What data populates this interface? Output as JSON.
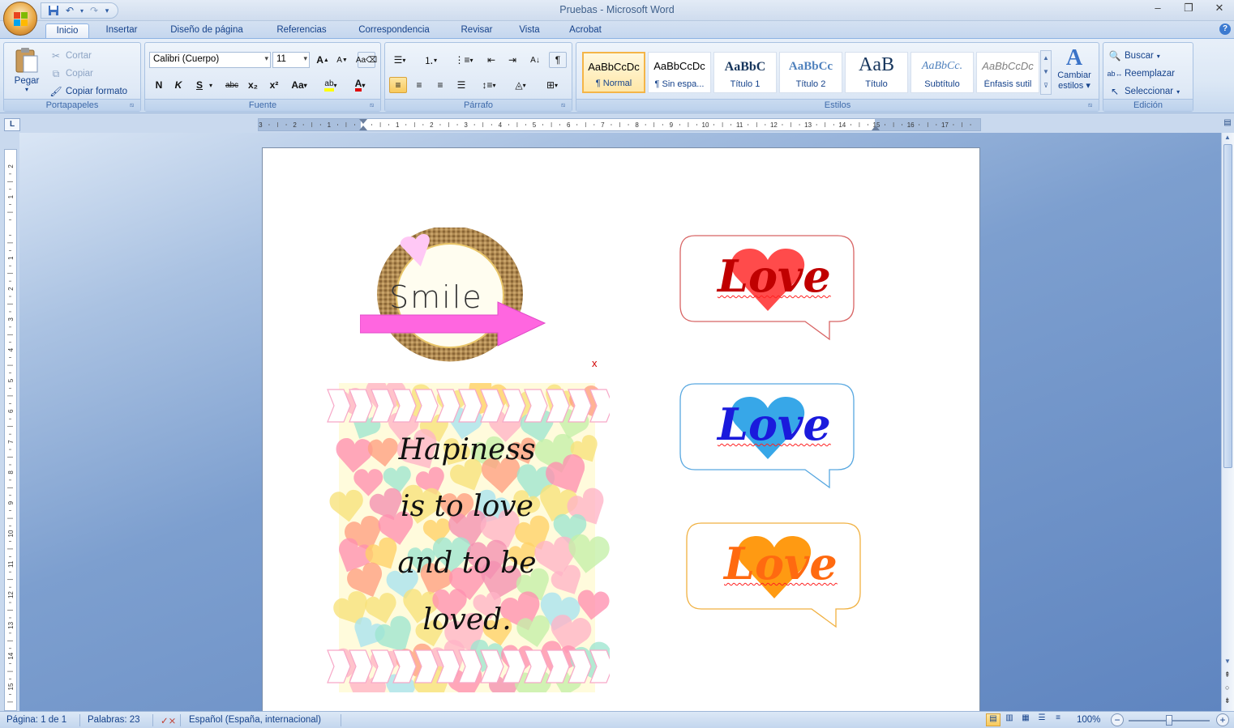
{
  "window": {
    "title": "Pruebas - Microsoft Word",
    "controls": [
      "–",
      "❐",
      "✕"
    ]
  },
  "tabs": [
    "Inicio",
    "Insertar",
    "Diseño de página",
    "Referencias",
    "Correspondencia",
    "Revisar",
    "Vista",
    "Acrobat"
  ],
  "active_tab": "Inicio",
  "clipboard": {
    "paste": "Pegar",
    "cut": "Cortar",
    "copy": "Copiar",
    "format_painter": "Copiar formato",
    "group_label": "Portapapeles"
  },
  "font": {
    "name": "Calibri (Cuerpo)",
    "size": "11",
    "group_label": "Fuente",
    "bold": "N",
    "italic": "K",
    "underline": "S",
    "strike": "abc",
    "subscript": "x₂",
    "superscript": "x²",
    "case": "Aa",
    "grow": "A",
    "shrink": "A",
    "highlight": "ab",
    "color": "A"
  },
  "paragraph": {
    "group_label": "Párrafo"
  },
  "styles": {
    "group_label": "Estilos",
    "items": [
      {
        "preview": "AaBbCcDc",
        "name": "¶ Normal"
      },
      {
        "preview": "AaBbCcDc",
        "name": "¶ Sin espa..."
      },
      {
        "preview": "AaBbC",
        "name": "Título 1"
      },
      {
        "preview": "AaBbCc",
        "name": "Título 2"
      },
      {
        "preview": "AaB",
        "name": "Título"
      },
      {
        "preview": "AaBbCc.",
        "name": "Subtítulo"
      },
      {
        "preview": "AaBbCcDc",
        "name": "Énfasis sutil"
      }
    ],
    "change_styles_line1": "Cambiar",
    "change_styles_line2": "estilos"
  },
  "editing": {
    "group_label": "Edición",
    "find": "Buscar",
    "replace": "Reemplazar",
    "select": "Seleccionar"
  },
  "document": {
    "smile_text": "Smile",
    "stray_mark": "x",
    "love_text": "Love",
    "quote_lines": [
      "Hapiness",
      "is to love",
      "and to be",
      "loved."
    ],
    "colors": {
      "love_red": "#c00000",
      "heart_red": "#ff4b4b",
      "love_blue": "#1a1adc",
      "heart_blue": "#37a7e8",
      "love_orange": "#ff6a10",
      "heart_orange": "#ff9a12",
      "arrow_pink": "#ff66e0"
    }
  },
  "status": {
    "page": "Página: 1 de 1",
    "words": "Palabras: 23",
    "language": "Español (España, internacional)",
    "zoom": "100%"
  }
}
